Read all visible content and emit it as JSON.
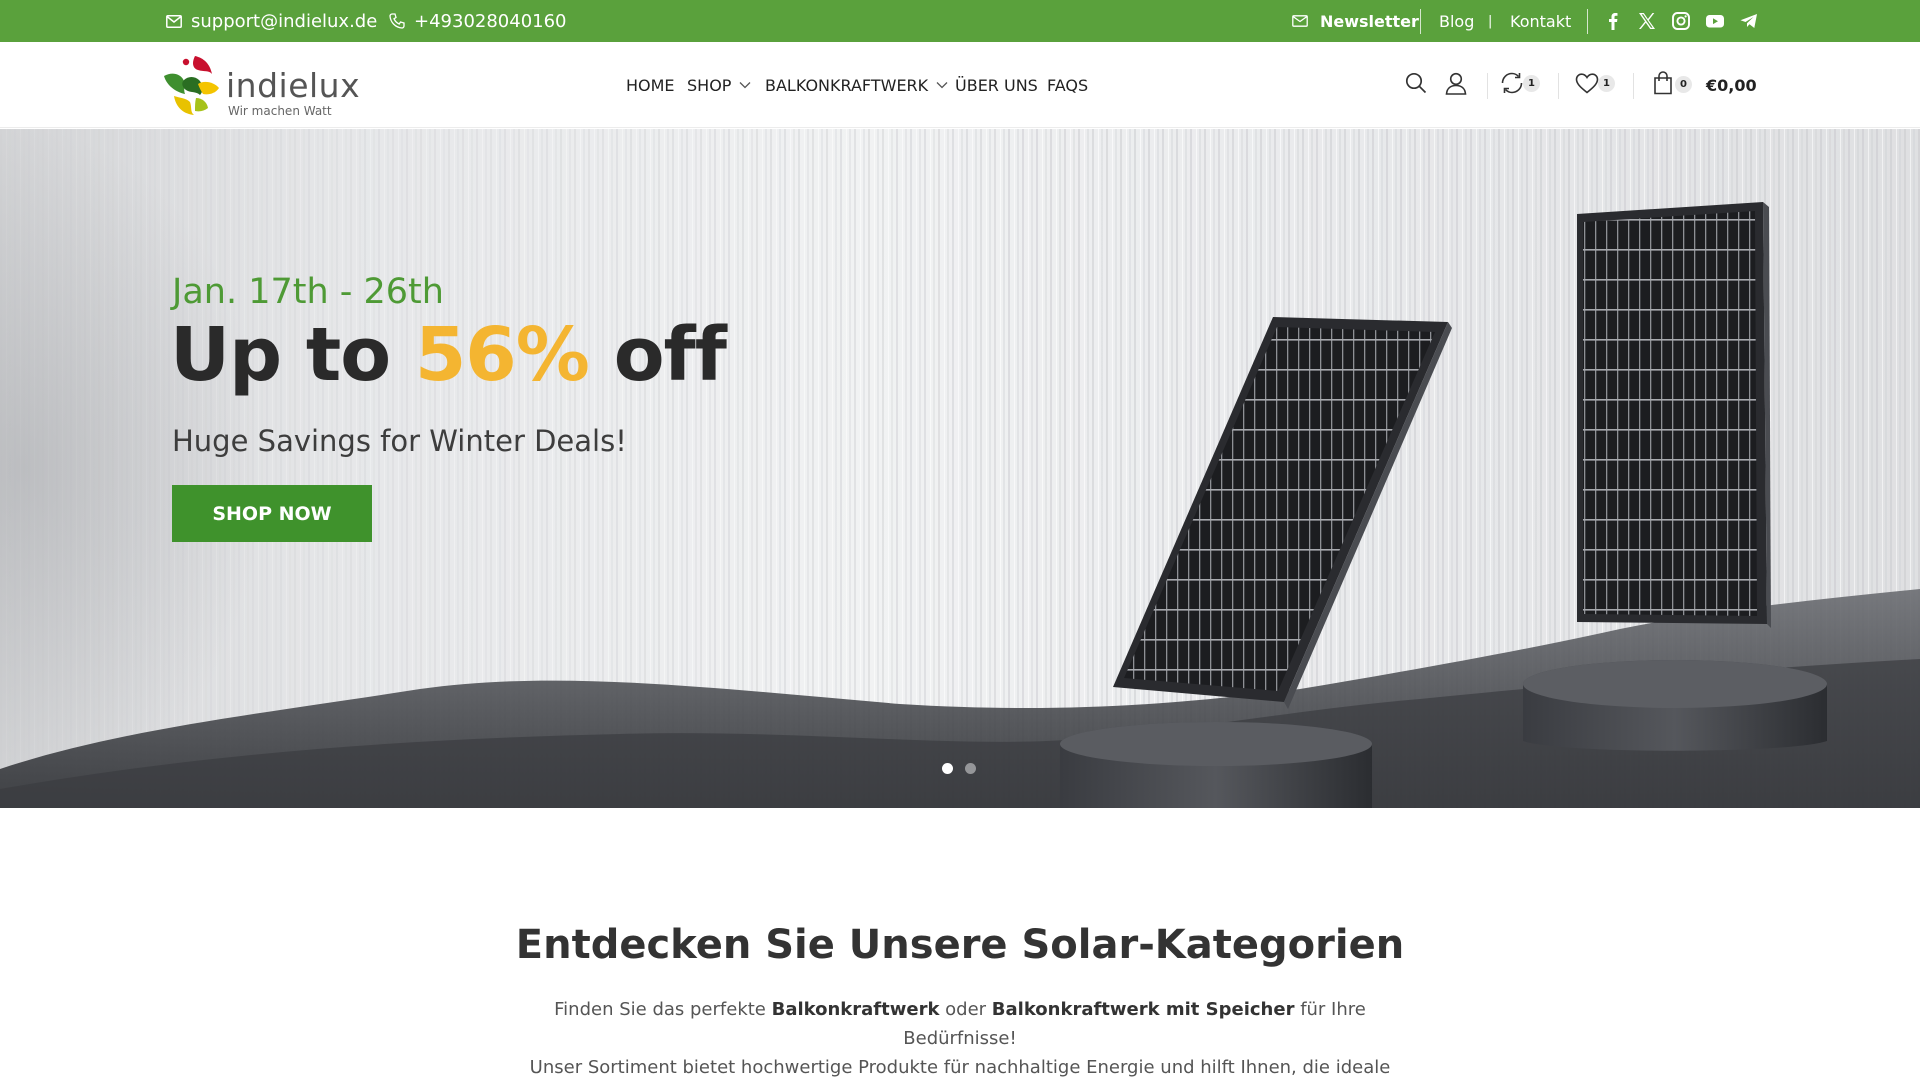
{
  "topbar": {
    "email": "support@indielux.de",
    "phone": "+493028040160",
    "newsletter": "Newsletter",
    "blog": "Blog",
    "separator": "|",
    "kontakt": "Kontakt",
    "social_icons": [
      "facebook-icon",
      "x-twitter-icon",
      "instagram-icon",
      "youtube-icon",
      "telegram-icon"
    ],
    "background": "#5aa13c"
  },
  "header": {
    "logo_name": "indielux",
    "logo_tagline": "Wir machen Watt",
    "nav": {
      "home": "HOME",
      "shop": "SHOP",
      "balkonkraftwerk": "BALKONKRAFTWERK",
      "ueber_uns": "ÜBER UNS",
      "faqs": "FAQS"
    },
    "compare_count": "1",
    "wishlist_count": "1",
    "cart_count": "0",
    "cart_total": "€0,00"
  },
  "hero": {
    "date": "Jan. 17th - 26th",
    "title_prefix": "Up to ",
    "title_highlight": "56%",
    "title_suffix": " off",
    "subtitle": "Huge Savings for Winter Deals!",
    "cta": "SHOP NOW",
    "slides_total": 2,
    "active_slide": 1,
    "accent": "#3f922c",
    "highlight_color": "#f4b531"
  },
  "categories": {
    "title": "Entdecken Sie Unsere Solar-Kategorien",
    "line1_pre": "Finden Sie das perfekte ",
    "line1_b1": "Balkonkraftwerk",
    "line1_mid": " oder ",
    "line1_b2": "Balkonkraftwerk mit Speicher",
    "line1_post": " für Ihre Bedürfnisse!",
    "line2": "Unser Sortiment bietet hochwertige Produkte für nachhaltige Energie und hilft Ihnen, die ideale Lösung zu finden."
  }
}
